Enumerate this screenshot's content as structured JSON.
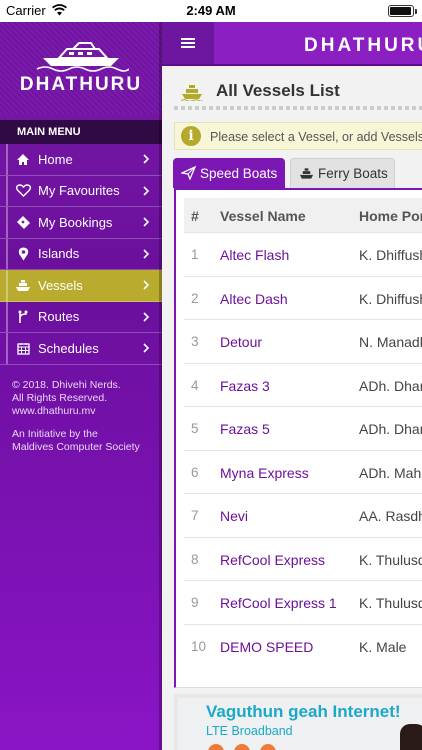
{
  "status_bar": {
    "carrier": "Carrier",
    "time": "2:49 AM"
  },
  "sidebar": {
    "logo_text": "DHATHURU",
    "menu_heading": "MAIN MENU",
    "items": [
      {
        "label": "Home",
        "icon": "home-icon",
        "active": false
      },
      {
        "label": "My Favourites",
        "icon": "heart-icon",
        "active": false
      },
      {
        "label": "My Bookings",
        "icon": "ticket-icon",
        "active": false
      },
      {
        "label": "Islands",
        "icon": "map-pin-icon",
        "active": false
      },
      {
        "label": "Vessels",
        "icon": "ship-icon",
        "active": true
      },
      {
        "label": "Routes",
        "icon": "route-icon",
        "active": false
      },
      {
        "label": "Schedules",
        "icon": "calendar-icon",
        "active": false
      }
    ],
    "copyright_line1": "© 2018. Dhivehi Nerds.",
    "copyright_line2": "All Rights Reserved.",
    "copyright_line3": "www.dhathuru.mv",
    "initiative_line1": "An Initiative by the",
    "initiative_line2": "Maldives Computer Society"
  },
  "header": {
    "brand": "DHATHURU"
  },
  "page": {
    "title": "All Vessels List",
    "info_message": "Please select a Vessel, or add Vessels t"
  },
  "tabs": [
    {
      "label": "Speed Boats",
      "active": true
    },
    {
      "label": "Ferry Boats",
      "active": false
    }
  ],
  "table": {
    "headers": {
      "num": "#",
      "name": "Vessel Name",
      "port": "Home Por"
    },
    "rows": [
      {
        "num": "1",
        "name": "Altec Flash",
        "port": "K. Dhiffush"
      },
      {
        "num": "2",
        "name": "Altec Dash",
        "port": "K. Dhiffush"
      },
      {
        "num": "3",
        "name": "Detour",
        "port": "N. Manadh"
      },
      {
        "num": "4",
        "name": "Fazas 3",
        "port": "ADh. Dhan"
      },
      {
        "num": "5",
        "name": "Fazas 5",
        "port": "ADh. Dhan"
      },
      {
        "num": "6",
        "name": "Myna Express",
        "port": "ADh. Mahi"
      },
      {
        "num": "7",
        "name": "Nevi",
        "port": "AA. Rasdh"
      },
      {
        "num": "8",
        "name": "RefCool Express",
        "port": "K. Thulusd"
      },
      {
        "num": "9",
        "name": "RefCool Express 1",
        "port": "K. Thulusd"
      },
      {
        "num": "10",
        "name": "DEMO SPEED",
        "port": "K. Male"
      }
    ]
  },
  "ad": {
    "headline": "Vaguthun geah Internet!",
    "subline": "LTE Broadband"
  },
  "colors": {
    "primary": "#8b1fc1",
    "active_item": "#b8ab2e",
    "link": "#6d1199",
    "ad_text": "#1aa9c8"
  }
}
